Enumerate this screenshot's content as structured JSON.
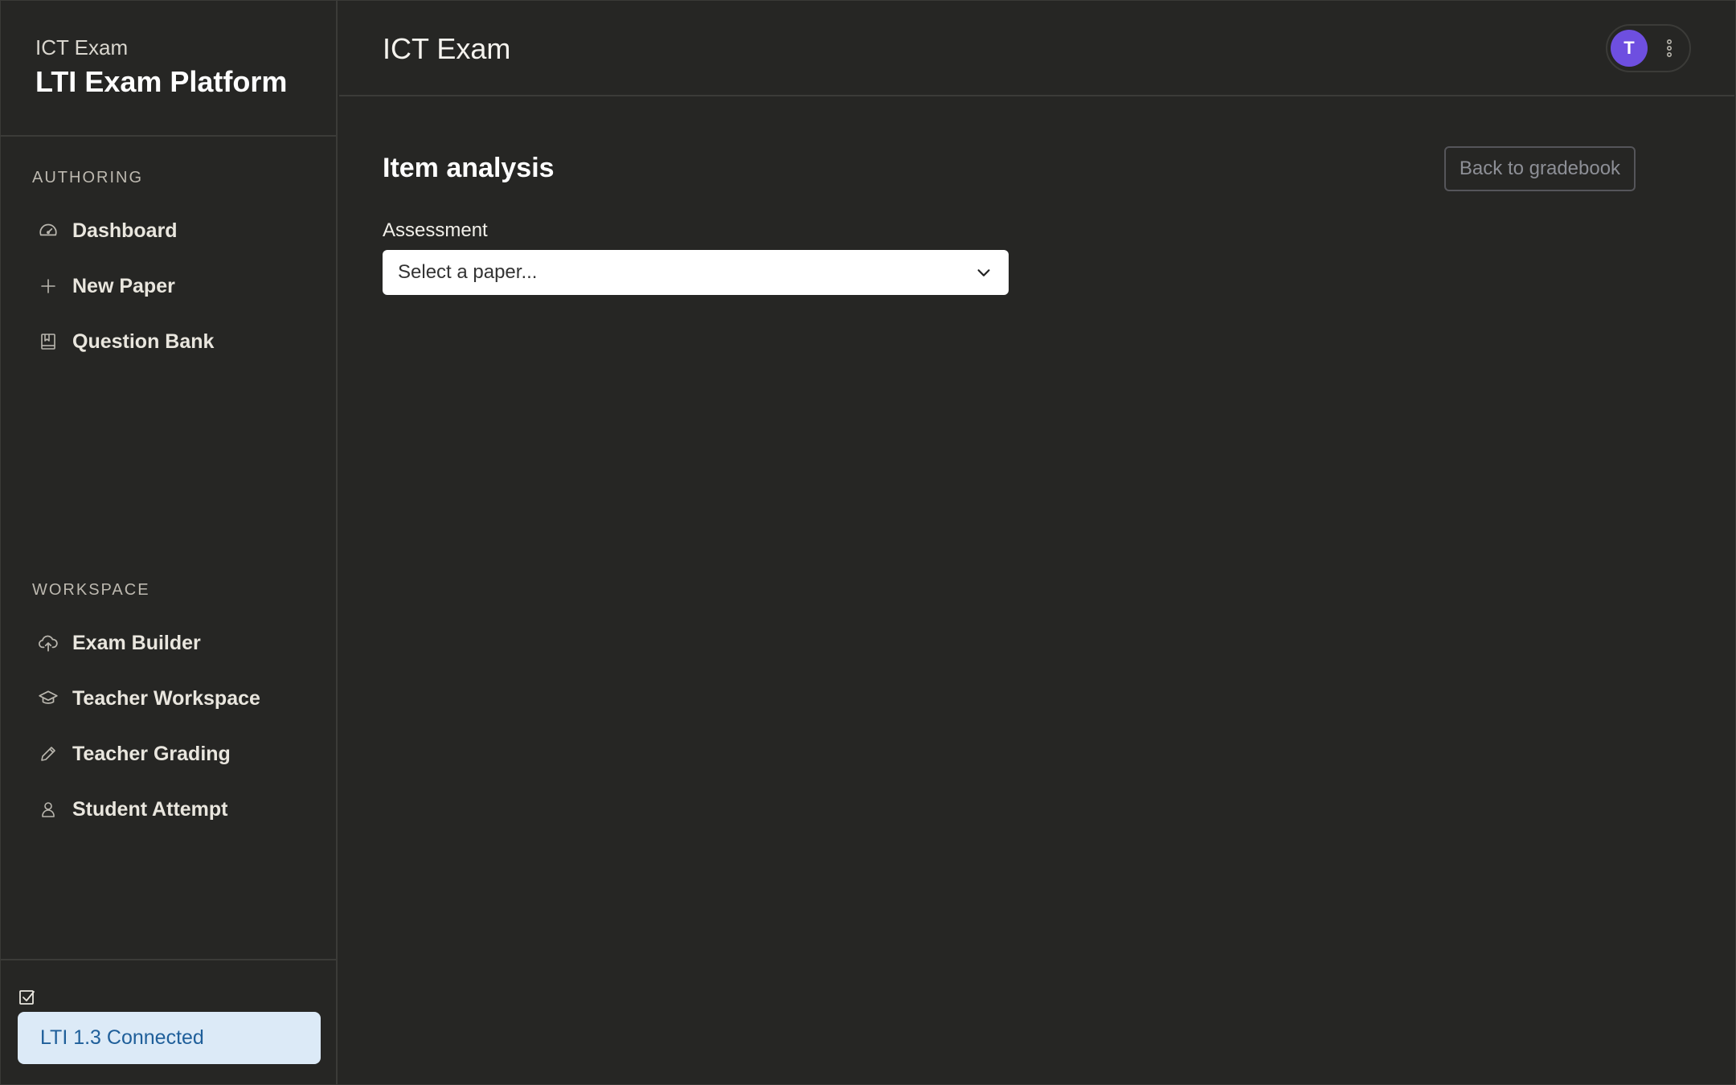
{
  "sidebar": {
    "brand_subtitle": "ICT Exam",
    "brand_title": "LTI Exam Platform",
    "sections": [
      {
        "label": "AUTHORING",
        "items": [
          {
            "label": "Dashboard",
            "icon": "gauge-icon"
          },
          {
            "label": "New Paper",
            "icon": "plus-icon"
          },
          {
            "label": "Question Bank",
            "icon": "book-icon"
          }
        ]
      },
      {
        "label": "WORKSPACE",
        "items": [
          {
            "label": "Exam Builder",
            "icon": "cloud-upload-icon"
          },
          {
            "label": "Teacher Workspace",
            "icon": "graduation-cap-icon"
          },
          {
            "label": "Teacher Grading",
            "icon": "pencil-icon"
          },
          {
            "label": "Student Attempt",
            "icon": "user-icon"
          }
        ]
      }
    ],
    "footer": {
      "icon": "checkbox-icon",
      "status_label": "LTI 1.3 Connected"
    }
  },
  "header": {
    "title": "ICT Exam",
    "user_initial": "T",
    "menu_icon": "kebab-menu-icon"
  },
  "main": {
    "page_title": "Item analysis",
    "back_button_label": "Back to gradebook",
    "assessment_label": "Assessment",
    "assessment_select_value": "Select a paper..."
  },
  "colors": {
    "background": "#262624",
    "avatar": "#6e4fe0",
    "status_badge_bg": "#dceaf7",
    "status_badge_text": "#1f5f9a"
  }
}
